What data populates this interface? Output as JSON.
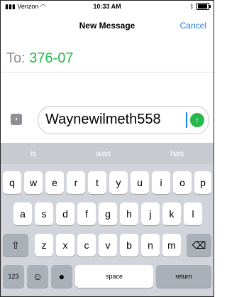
{
  "status": {
    "carrier": "Verizon",
    "time": "10:33 AM"
  },
  "nav": {
    "title": "New Message",
    "cancel": "Cancel"
  },
  "to": {
    "label": "To:",
    "recipient": "376-07"
  },
  "compose": {
    "text": "Waynewilmeth558"
  },
  "suggestions": [
    "is",
    "was",
    "has"
  ],
  "keyboard": {
    "row1": [
      "q",
      "w",
      "e",
      "r",
      "t",
      "y",
      "u",
      "i",
      "o",
      "p"
    ],
    "row2": [
      "a",
      "s",
      "d",
      "f",
      "g",
      "h",
      "j",
      "k",
      "l"
    ],
    "row3": [
      "z",
      "x",
      "c",
      "v",
      "b",
      "n",
      "m"
    ],
    "bottom": {
      "numbers": "123",
      "space": "space",
      "return": "return"
    }
  },
  "icons": {
    "shift": "shift-icon",
    "delete": "backspace-icon",
    "emoji": "emoji-icon",
    "mic": "mic-icon",
    "wifi": "wifi-icon",
    "battery": "battery-icon",
    "send": "send-icon",
    "expand": "expand-icon"
  },
  "colors": {
    "accent": "#1a7ee6",
    "green": "#25b84a"
  }
}
